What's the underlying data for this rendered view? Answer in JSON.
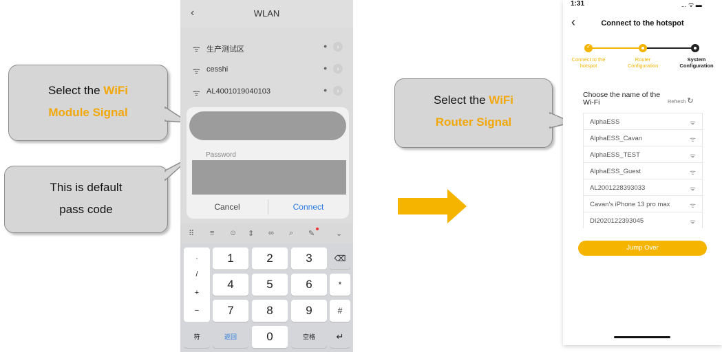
{
  "callouts": {
    "module": {
      "line1": "Select the ",
      "highlight": "WiFi",
      "line2": "Module Signal"
    },
    "passcode": {
      "line1": "This is default",
      "line2": "pass code"
    },
    "router": {
      "line1": "Select the ",
      "highlight": "WiFi",
      "line2": "Router Signal"
    }
  },
  "colors": {
    "accent": "#f5b400",
    "highlight_text": "#f2a70a",
    "arrow": "#f5b400"
  },
  "left_phone": {
    "title": "WLAN",
    "networks": [
      {
        "name": "生产测试区"
      },
      {
        "name": "cesshi"
      },
      {
        "name": "AL4001019040103"
      }
    ],
    "dialog": {
      "password_label": "Password",
      "cancel_label": "Cancel",
      "connect_label": "Connect"
    },
    "keyboard": {
      "side_keys": [
        ".",
        "/",
        "+",
        "−"
      ],
      "rows": [
        [
          "1",
          "2",
          "3"
        ],
        [
          "4",
          "5",
          "6"
        ],
        [
          "7",
          "8",
          "9"
        ]
      ],
      "right_keys": [
        "⌫",
        "*",
        "#"
      ],
      "bottom": {
        "symbol": "符",
        "back": "返回",
        "zero": "0",
        "space": "空格",
        "enter": "↵"
      }
    }
  },
  "right_phone": {
    "time": "1:31",
    "status_icons": "... ᯤ ▬",
    "title": "Connect to the hotspot",
    "steps": [
      {
        "line1": "Connect to the",
        "line2": "hotspot"
      },
      {
        "line1": "Router",
        "line2": "Configuration"
      },
      {
        "line1": "System",
        "line2": "Configuration"
      }
    ],
    "choose_label_1": "Choose the name of the",
    "choose_label_2": "Wi-Fi",
    "refresh_label": "Refresh",
    "wifi_list": [
      "AlphaESS",
      "AlphaESS_Cavan",
      "AlphaESS_TEST",
      "AlphaESS_Guest",
      "AL2001228393033",
      "Cavan's iPhone 13 pro max",
      "DI2020122393045"
    ],
    "jump_over_label": "Jump Over"
  }
}
